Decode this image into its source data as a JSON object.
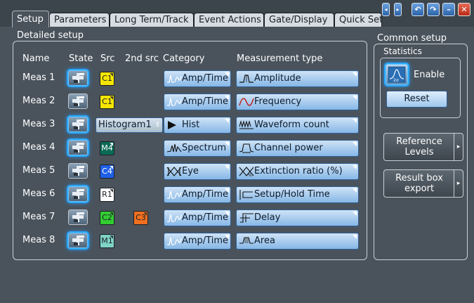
{
  "tabs": [
    {
      "label": "Setup",
      "active": true
    },
    {
      "label": "Parameters"
    },
    {
      "label": "Long Term/Track"
    },
    {
      "label": "Event Actions"
    },
    {
      "label": "Gate/Display"
    },
    {
      "label": "Quick Set"
    }
  ],
  "window_buttons": [
    "scroll-left-icon",
    "scroll-right-icon",
    "undo-icon",
    "redo-icon",
    "minimize-icon",
    "close-icon"
  ],
  "detailed_setup": {
    "title": "Detailed setup",
    "headers": {
      "name": "Name",
      "state": "State",
      "src": "Src",
      "src2": "2nd src",
      "category": "Category",
      "type": "Measurement type"
    },
    "rows": [
      {
        "name": "Meas 1",
        "state_on": true,
        "src": "C1",
        "src_color": "#f5e600",
        "src2": "",
        "src2_color": "",
        "category": "Amp/Time",
        "category_icon": "amp-time-icon",
        "type": "Amplitude",
        "type_icon": "amplitude-icon"
      },
      {
        "name": "Meas 2",
        "state_on": false,
        "src": "C1",
        "src_color": "#f5e600",
        "src2": "",
        "src2_color": "",
        "category": "Amp/Time",
        "category_icon": "amp-time-icon",
        "type": "Frequency",
        "type_icon": "frequency-icon"
      },
      {
        "name": "Meas 3",
        "state_on": true,
        "src": "Histogram1",
        "src_color": "",
        "src2": "",
        "src2_color": "",
        "category": "Hist",
        "category_icon": "histogram-icon",
        "type": "Waveform count",
        "type_icon": "waveform-count-icon"
      },
      {
        "name": "Meas 4",
        "state_on": true,
        "src": "M4",
        "src_color": "#0b6a55",
        "src2": "",
        "src2_color": "",
        "category": "Spectrum",
        "category_icon": "spectrum-icon",
        "type": "Channel power",
        "type_icon": "channel-power-icon"
      },
      {
        "name": "Meas 5",
        "state_on": false,
        "src": "C4",
        "src_color": "#2060e8",
        "src2": "",
        "src2_color": "",
        "category": "Eye",
        "category_icon": "eye-icon",
        "type": "Extinction ratio (%)",
        "type_icon": "extinction-ratio-icon"
      },
      {
        "name": "Meas 6",
        "state_on": true,
        "src": "R1",
        "src_color": "#ffffff",
        "src2": "",
        "src2_color": "",
        "category": "Amp/Time",
        "category_icon": "amp-time-icon",
        "type": "Setup/Hold Time",
        "type_icon": "setup-hold-icon"
      },
      {
        "name": "Meas 7",
        "state_on": false,
        "src": "C2",
        "src_color": "#33cc33",
        "src2": "C3",
        "src2_color": "#f07020",
        "category": "Amp/Time",
        "category_icon": "amp-time-icon",
        "type": "Delay",
        "type_icon": "delay-icon"
      },
      {
        "name": "Meas 8",
        "state_on": true,
        "src": "M1",
        "src_color": "#7fd4c8",
        "src2": "",
        "src2_color": "",
        "category": "Amp/Time",
        "category_icon": "amp-time-icon",
        "type": "Area",
        "type_icon": "area-icon"
      }
    ]
  },
  "common_setup": {
    "title": "Common setup",
    "statistics_label": "Statistics",
    "enable_label": "Enable",
    "enable_icon_text": "2σ",
    "reset_label": "Reset",
    "reference_levels_label": "Reference Levels",
    "result_box_label": "Result box export"
  }
}
